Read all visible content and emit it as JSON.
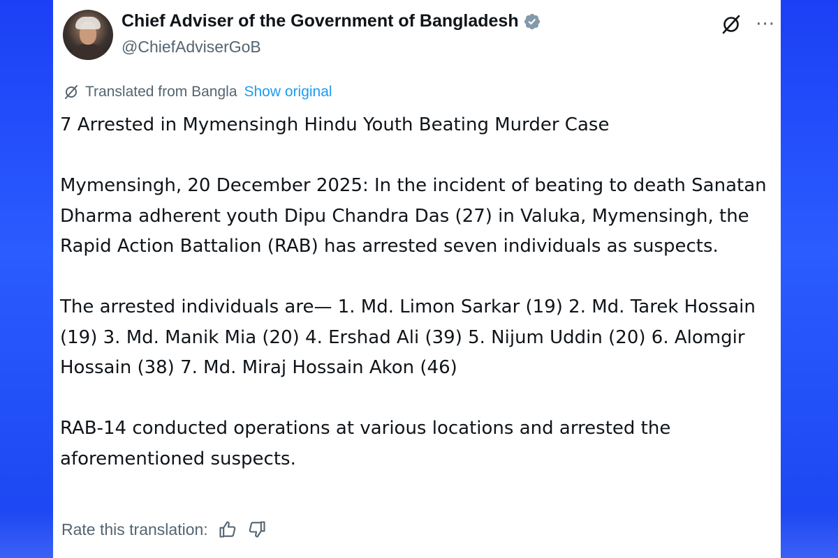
{
  "author": {
    "display_name": "Chief Adviser of the Government of Bangladesh",
    "handle": "@ChiefAdviserGoB",
    "verified_icon": "verified-badge-icon",
    "avatar_icon": "profile-photo"
  },
  "actions": {
    "grok_icon": "grok-icon",
    "more_label": "···"
  },
  "translation": {
    "label": "Translated from Bangla",
    "show_original": "Show original"
  },
  "post": {
    "headline": "7 Arrested in Mymensingh Hindu Youth Beating Murder Case",
    "paragraph_1": "Mymensingh, 20 December 2025: In the incident of beating to death Sanatan Dharma adherent youth Dipu Chandra Das (27) in Valuka, Mymensingh, the Rapid Action Battalion (RAB) has arrested seven individuals as suspects.",
    "paragraph_2": "The arrested individuals are— 1. Md. Limon Sarkar (19) 2. Md. Tarek Hossain (19) 3. Md. Manik Mia (20) 4. Ershad Ali (39) 5. Nijum Uddin (20) 6. Alomgir Hossain (38) 7. Md. Miraj Hossain Akon (46)",
    "paragraph_3": "RAB-14 conducted operations at various locations and arrested the aforementioned suspects."
  },
  "rating": {
    "label": "Rate this translation:",
    "thumbs_up_icon": "thumbs-up-icon",
    "thumbs_down_icon": "thumbs-down-icon"
  },
  "colors": {
    "background_blue": "#2b5cff",
    "text_primary": "#0f1419",
    "text_secondary": "#536471",
    "link": "#1d9bf0",
    "verified": "#829aab"
  }
}
